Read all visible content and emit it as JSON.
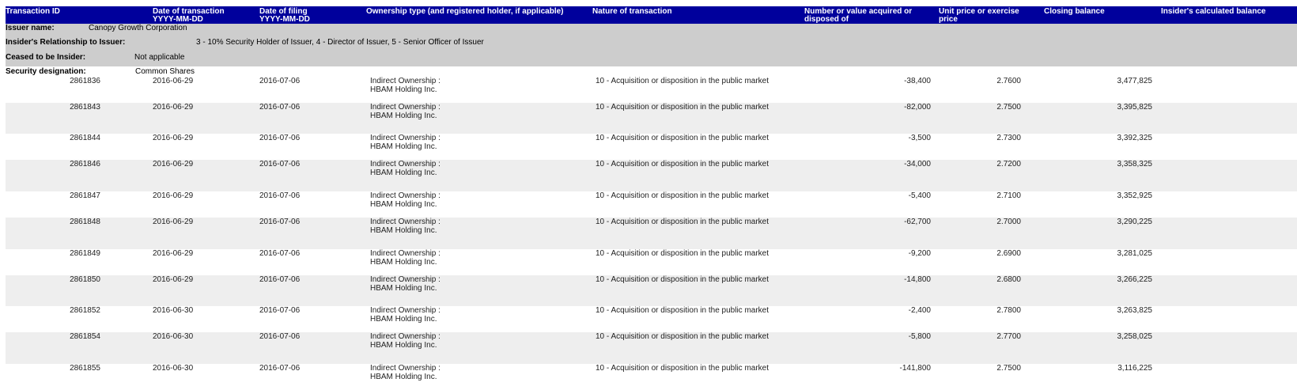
{
  "header": {
    "transaction_id": "Transaction ID",
    "date_transaction": [
      "Date of transaction",
      "YYYY-MM-DD"
    ],
    "date_filing": [
      "Date of filing",
      "YYYY-MM-DD"
    ],
    "ownership": "Ownership type (and registered holder, if applicable)",
    "nature": "Nature of transaction",
    "number_value": [
      "Number or value acquired or",
      "disposed of"
    ],
    "unit_price": [
      "Unit price or exercise",
      "price"
    ],
    "closing_balance": "Closing balance",
    "calculated_balance": "Insider's calculated balance"
  },
  "issuer": {
    "name_label": "Issuer name:",
    "name_value": "Canopy Growth Corporation",
    "relationship_label": "Insider's Relationship to Issuer:",
    "relationship_value": "3 - 10% Security Holder of Issuer, 4 - Director of Issuer, 5 - Senior Officer of Issuer",
    "ceased_label": "Ceased to be Insider:",
    "ceased_value": "Not applicable",
    "security_label": "Security designation:",
    "security_value": "Common Shares"
  },
  "transactions": [
    {
      "id": "2861836",
      "date": "2016-06-29",
      "filing": "2016-07-06",
      "own1": "Indirect Ownership :",
      "own2": "HBAM Holding Inc.",
      "nature": "10 - Acquisition or disposition in the public market",
      "number": "-38,400",
      "price": "2.7600",
      "closing": "3,477,825"
    },
    {
      "id": "2861843",
      "date": "2016-06-29",
      "filing": "2016-07-06",
      "own1": "Indirect Ownership :",
      "own2": "HBAM Holding Inc.",
      "nature": "10 - Acquisition or disposition in the public market",
      "number": "-82,000",
      "price": "2.7500",
      "closing": "3,395,825"
    },
    {
      "id": "2861844",
      "date": "2016-06-29",
      "filing": "2016-07-06",
      "own1": "Indirect Ownership :",
      "own2": "HBAM Holding Inc.",
      "nature": "10 - Acquisition or disposition in the public market",
      "number": "-3,500",
      "price": "2.7300",
      "closing": "3,392,325"
    },
    {
      "id": "2861846",
      "date": "2016-06-29",
      "filing": "2016-07-06",
      "own1": "Indirect Ownership :",
      "own2": "HBAM Holding Inc.",
      "nature": "10 - Acquisition or disposition in the public market",
      "number": "-34,000",
      "price": "2.7200",
      "closing": "3,358,325"
    },
    {
      "id": "2861847",
      "date": "2016-06-29",
      "filing": "2016-07-06",
      "own1": "Indirect Ownership :",
      "own2": "HBAM Holding Inc.",
      "nature": "10 - Acquisition or disposition in the public market",
      "number": "-5,400",
      "price": "2.7100",
      "closing": "3,352,925"
    },
    {
      "id": "2861848",
      "date": "2016-06-29",
      "filing": "2016-07-06",
      "own1": "Indirect Ownership :",
      "own2": "HBAM Holding Inc.",
      "nature": "10 - Acquisition or disposition in the public market",
      "number": "-62,700",
      "price": "2.7000",
      "closing": "3,290,225"
    },
    {
      "id": "2861849",
      "date": "2016-06-29",
      "filing": "2016-07-06",
      "own1": "Indirect Ownership :",
      "own2": "HBAM Holding Inc.",
      "nature": "10 - Acquisition or disposition in the public market",
      "number": "-9,200",
      "price": "2.6900",
      "closing": "3,281,025"
    },
    {
      "id": "2861850",
      "date": "2016-06-29",
      "filing": "2016-07-06",
      "own1": "Indirect Ownership :",
      "own2": "HBAM Holding Inc.",
      "nature": "10 - Acquisition or disposition in the public market",
      "number": "-14,800",
      "price": "2.6800",
      "closing": "3,266,225"
    },
    {
      "id": "2861852",
      "date": "2016-06-30",
      "filing": "2016-07-06",
      "own1": "Indirect Ownership :",
      "own2": "HBAM Holding Inc.",
      "nature": "10 - Acquisition or disposition in the public market",
      "number": "-2,400",
      "price": "2.7800",
      "closing": "3,263,825"
    },
    {
      "id": "2861854",
      "date": "2016-06-30",
      "filing": "2016-07-06",
      "own1": "Indirect Ownership :",
      "own2": "HBAM Holding Inc.",
      "nature": "10 - Acquisition or disposition in the public market",
      "number": "-5,800",
      "price": "2.7700",
      "closing": "3,258,025"
    },
    {
      "id": "2861855",
      "date": "2016-06-30",
      "filing": "2016-07-06",
      "own1": "Indirect Ownership :",
      "own2": "HBAM Holding Inc.",
      "nature": "10 - Acquisition or disposition in the public market",
      "number": "-141,800",
      "price": "2.7500",
      "closing": "3,116,225"
    }
  ]
}
